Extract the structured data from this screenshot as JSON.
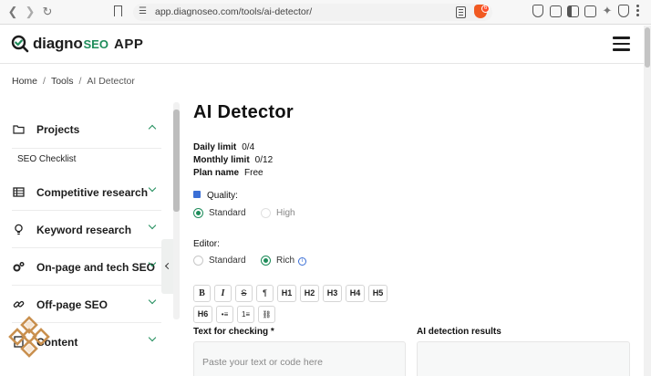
{
  "browser": {
    "url": "app.diagnoseo.com/tools/ai-detector/",
    "extension_badge": "6"
  },
  "header": {
    "logo_text": "diagno",
    "logo_seo": "SEO",
    "logo_app": "APP"
  },
  "breadcrumb": {
    "items": [
      "Home",
      "Tools",
      "AI Detector"
    ],
    "separator": "/"
  },
  "sidebar": {
    "items": [
      {
        "label": "Projects",
        "icon": "folder-icon",
        "expanded": true
      },
      {
        "label": "Competitive research",
        "icon": "table-icon",
        "expanded": false
      },
      {
        "label": "Keyword research",
        "icon": "lightbulb-icon",
        "expanded": false
      },
      {
        "label": "On-page and tech SEO",
        "icon": "gears-icon",
        "expanded": false
      },
      {
        "label": "Off-page SEO",
        "icon": "link-icon",
        "expanded": false
      },
      {
        "label": "Content",
        "icon": "document-icon",
        "expanded": false
      }
    ],
    "projects_sub": "SEO Checklist"
  },
  "main": {
    "title": "AI Detector",
    "stats": [
      {
        "label": "Daily limit",
        "value": "0/4"
      },
      {
        "label": "Monthly limit",
        "value": "0/12"
      },
      {
        "label": "Plan name",
        "value": "Free"
      }
    ],
    "quality": {
      "label": "Quality:",
      "options": [
        {
          "label": "Standard",
          "checked": true,
          "disabled": false
        },
        {
          "label": "High",
          "checked": false,
          "disabled": true
        }
      ]
    },
    "editor": {
      "label": "Editor:",
      "options": [
        {
          "label": "Standard",
          "checked": false
        },
        {
          "label": "Rich",
          "checked": true
        }
      ],
      "info": "i"
    },
    "toolbar": {
      "row1": [
        "B",
        "I",
        "S",
        "¶",
        "H1",
        "H2",
        "H3",
        "H4",
        "H5"
      ],
      "row2": [
        "H6",
        "•≡",
        "1≡",
        "⛓"
      ]
    },
    "text_label": "Text for checking *",
    "text_placeholder": "Paste your text or code here",
    "results_label": "AI detection results"
  },
  "colors": {
    "accent": "#1e8c5a",
    "link_blue": "#3b6fd6"
  }
}
